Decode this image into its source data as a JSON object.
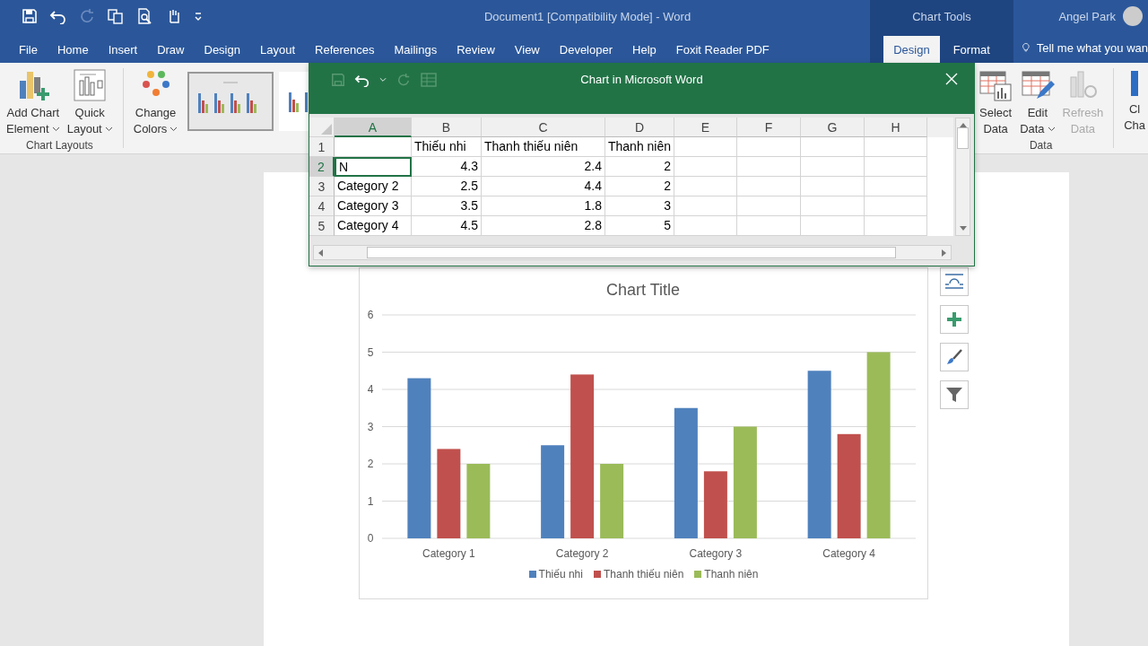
{
  "window": {
    "title": "Document1 [Compatibility Mode]  -  Word",
    "contextual_title": "Chart Tools",
    "user": "Angel Park"
  },
  "tabs": [
    {
      "label": "File",
      "selected": false
    },
    {
      "label": "Home",
      "selected": false
    },
    {
      "label": "Insert",
      "selected": false
    },
    {
      "label": "Draw",
      "selected": false
    },
    {
      "label": "Design",
      "selected": false
    },
    {
      "label": "Layout",
      "selected": false
    },
    {
      "label": "References",
      "selected": false
    },
    {
      "label": "Mailings",
      "selected": false
    },
    {
      "label": "Review",
      "selected": false
    },
    {
      "label": "View",
      "selected": false
    },
    {
      "label": "Developer",
      "selected": false
    },
    {
      "label": "Help",
      "selected": false
    },
    {
      "label": "Foxit Reader PDF",
      "selected": false
    }
  ],
  "contextual_tabs": [
    {
      "label": "Design",
      "selected": true
    },
    {
      "label": "Format",
      "selected": false
    }
  ],
  "tell_me": {
    "label": "Tell me what you wan"
  },
  "ribbon": {
    "left_groups": [
      {
        "label": "Chart Layouts",
        "buttons": [
          {
            "kind": "add-chart",
            "lines": [
              "Add Chart",
              "Element"
            ],
            "dropdown": true,
            "disabled": false
          },
          {
            "kind": "quick-layout",
            "lines": [
              "Quick",
              "Layout"
            ],
            "dropdown": true,
            "disabled": false
          }
        ]
      },
      {
        "buttons": [
          {
            "kind": "change-colors",
            "lines": [
              "Change",
              "Colors"
            ],
            "dropdown": true,
            "disabled": false
          }
        ],
        "style_gallery": [
          {
            "selected": true
          },
          {
            "selected": false
          }
        ]
      }
    ],
    "right_groups": [
      {
        "label": "Data",
        "buttons": [
          {
            "kind": "select-data",
            "lines": [
              "Select",
              "Data"
            ],
            "dropdown": false,
            "disabled": false
          },
          {
            "kind": "edit-data",
            "lines": [
              "Edit",
              "Data"
            ],
            "dropdown": true,
            "disabled": false
          },
          {
            "kind": "refresh-data",
            "lines": [
              "Refresh",
              "Data"
            ],
            "dropdown": false,
            "disabled": true
          }
        ]
      },
      {
        "buttons": [
          {
            "kind": "chart-type",
            "lines": [
              "Cl",
              "Cha"
            ],
            "dropdown": false,
            "disabled": false
          }
        ]
      }
    ]
  },
  "dialog": {
    "title": "Chart in Microsoft Word",
    "sheet": {
      "columns": [
        {
          "label": "A",
          "selected": true
        },
        {
          "label": "B",
          "selected": false
        },
        {
          "label": "C",
          "selected": false
        },
        {
          "label": "D",
          "selected": false
        },
        {
          "label": "E",
          "selected": false
        },
        {
          "label": "F",
          "selected": false
        },
        {
          "label": "G",
          "selected": false
        },
        {
          "label": "H",
          "selected": false
        }
      ],
      "rows": [
        {
          "number": "1",
          "kind": "header",
          "selected": false,
          "cells": [
            null,
            "Thiếu nhi",
            "Thanh thiếu niên",
            "Thanh niên"
          ]
        },
        {
          "number": "2",
          "kind": "data",
          "selected": true,
          "cells": [
            "N",
            "4.3",
            "2.4",
            "2"
          ]
        },
        {
          "number": "3",
          "kind": "data",
          "selected": false,
          "cells": [
            "Category 2",
            "2.5",
            "4.4",
            "2"
          ]
        },
        {
          "number": "4",
          "kind": "data",
          "selected": false,
          "cells": [
            "Category 3",
            "3.5",
            "1.8",
            "3"
          ]
        },
        {
          "number": "5",
          "kind": "data",
          "selected": false,
          "cells": [
            "Category 4",
            "4.5",
            "2.8",
            "5"
          ]
        }
      ]
    }
  },
  "chart_data": {
    "type": "bar",
    "title": "Chart Title",
    "categories": [
      "Category 1",
      "Category 2",
      "Category 3",
      "Category 4"
    ],
    "series": [
      {
        "name": "Thiếu nhi",
        "color": "#4f81bd",
        "values": [
          4.3,
          2.5,
          3.5,
          4.5
        ]
      },
      {
        "name": "Thanh thiếu niên",
        "color": "#c0504d",
        "values": [
          2.4,
          4.4,
          1.8,
          2.8
        ]
      },
      {
        "name": "Thanh niên",
        "color": "#9bbb59",
        "values": [
          2,
          2,
          3,
          5
        ]
      }
    ],
    "ylim": [
      0,
      6
    ],
    "yticks": [
      0,
      1,
      2,
      3,
      4,
      5,
      6
    ],
    "grid": true,
    "legend": "bottom"
  }
}
